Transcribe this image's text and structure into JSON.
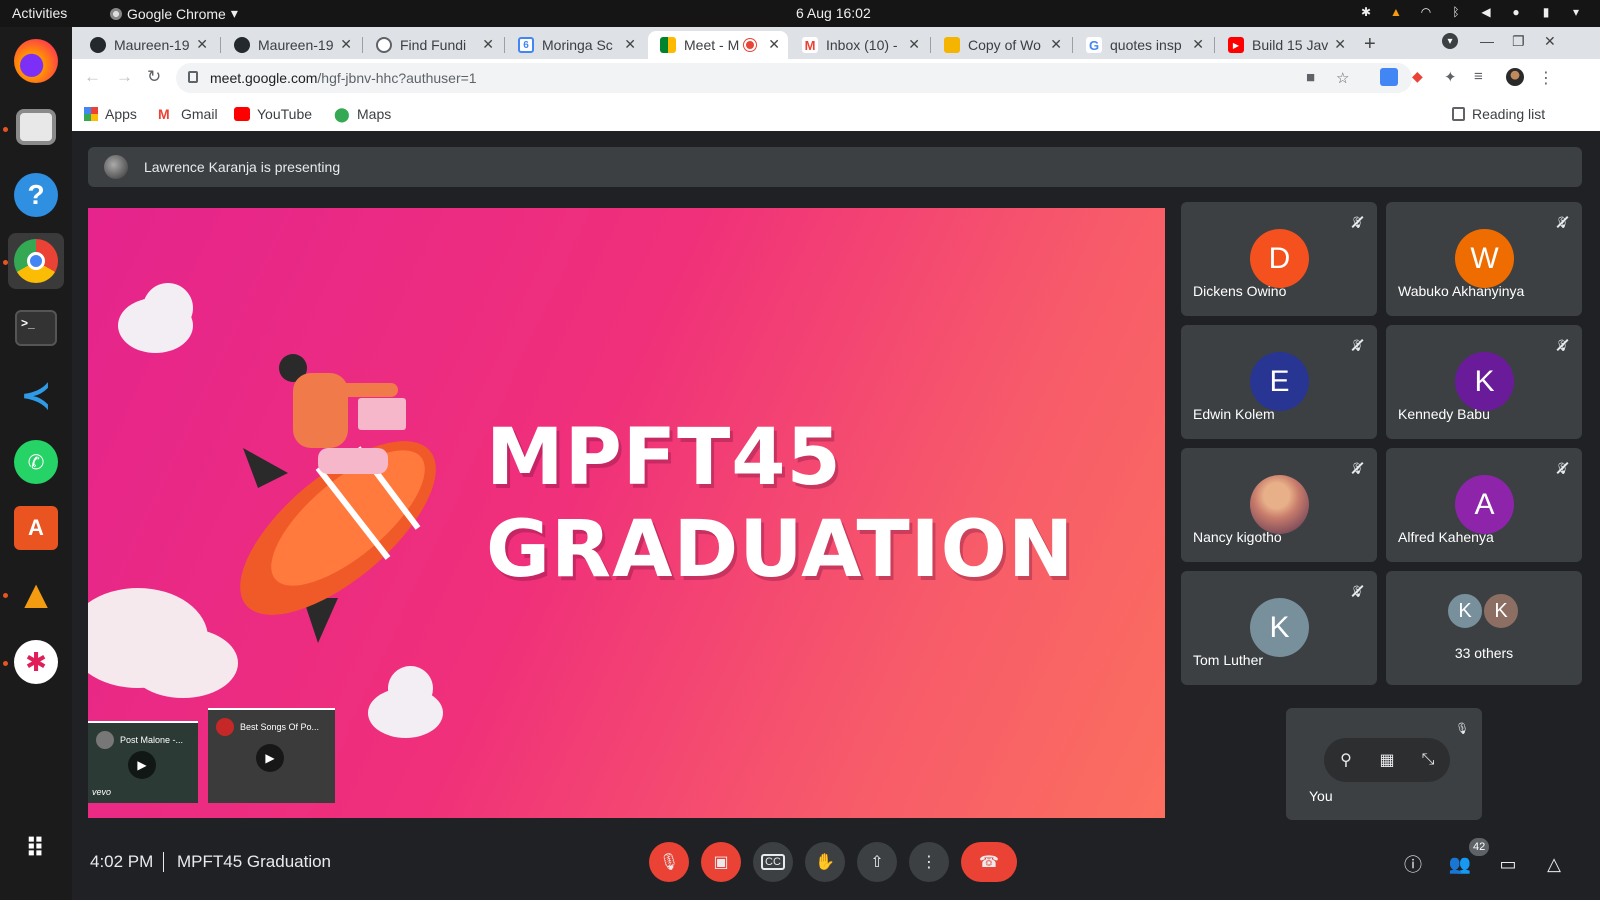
{
  "system_bar": {
    "activities": "Activities",
    "app_name": "Google Chrome",
    "clock": "6 Aug  16:02"
  },
  "dock": {
    "apps": [
      "firefox-icon",
      "files-icon",
      "help-icon",
      "chrome-icon",
      "terminal-icon",
      "vscode-icon",
      "whatsapp-icon",
      "software-center-icon",
      "vlc-icon",
      "slack-icon",
      "show-apps-icon"
    ]
  },
  "browser": {
    "tabs": [
      {
        "label": "Maureen-19",
        "icon": "github-icon"
      },
      {
        "label": "Maureen-19",
        "icon": "github-icon"
      },
      {
        "label": "Find Fundi",
        "icon": "globe-icon"
      },
      {
        "label": "Moringa Sc",
        "icon": "calendar-icon"
      },
      {
        "label": "Meet - M",
        "icon": "meet-icon"
      },
      {
        "label": "Inbox (10) -",
        "icon": "gmail-icon"
      },
      {
        "label": "Copy of Wo",
        "icon": "slides-icon"
      },
      {
        "label": "quotes insp",
        "icon": "google-icon"
      },
      {
        "label": "Build 15 Jav",
        "icon": "youtube-icon"
      }
    ],
    "url_host": "meet.google.com",
    "url_path": "/hgf-jbnv-hhc?authuser=1",
    "bookmarks": [
      "Apps",
      "Gmail",
      "YouTube",
      "Maps"
    ],
    "reading_list": "Reading list"
  },
  "meet": {
    "presenting_banner": "Lawrence Karanja is presenting",
    "slide": {
      "line1": "MPFT45",
      "line2": "GRADUATION"
    },
    "video_thumbs": [
      {
        "title": "Post Malone -...",
        "tag": "vevo"
      },
      {
        "title": "Best Songs Of Po..."
      }
    ],
    "participants": [
      {
        "name": "Dickens Owino",
        "initial": "D",
        "color": "#f4511e"
      },
      {
        "name": "Wabuko Akhanyinya",
        "initial": "W",
        "color": "#ef6c00"
      },
      {
        "name": "Edwin Kolem",
        "initial": "E",
        "color": "#283593"
      },
      {
        "name": "Kennedy Babu",
        "initial": "K",
        "color": "#6a1b9a"
      },
      {
        "name": "Nancy kigotho",
        "initial": "",
        "color": "#c77b6b"
      },
      {
        "name": "Alfred Kahenya",
        "initial": "A",
        "color": "#8e24aa"
      },
      {
        "name": "Tom Luther",
        "initial": "K",
        "color": "#78909c"
      }
    ],
    "others": {
      "label": "33 others",
      "initials": [
        "K",
        "K"
      ]
    },
    "self_label": "You",
    "meeting_time": "4:02 PM",
    "meeting_name": "MPFT45 Graduation",
    "participant_count": "42"
  }
}
